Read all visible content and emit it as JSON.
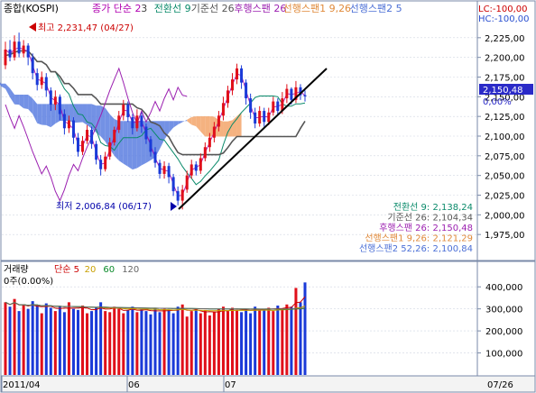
{
  "chart_data": [
    {
      "type": "candlestick",
      "title": "종합(KOSPI)",
      "legend": [
        {
          "text": "종가 단순 2",
          "color": "#b000b0"
        },
        {
          "text": "3",
          "color": "#404040"
        },
        {
          "text": "전환선 9",
          "color": "#0a8a6a"
        },
        {
          "text": "기준선 26",
          "color": "#555555"
        },
        {
          "text": "후행스팬 26",
          "color": "#9b1fb0"
        },
        {
          "text": "선행스팬1 9,26",
          "color": "#e08a3a"
        },
        {
          "text": "선행스팬2 5",
          "color": "#4b6fd6"
        }
      ],
      "lc_label": "LC:-100,00",
      "hc_label": "HC:-100,00",
      "ylim": [
        1950,
        2250
      ],
      "y_ticks": [
        "2,225,00",
        "2,200,00",
        "2,175,00",
        "2,150,00",
        "2,125,00",
        "2,100,00",
        "2,075,00",
        "2,050,00",
        "2,025,00",
        "2,000,00",
        "1,975,00"
      ],
      "y_tick_values": [
        2225,
        2200,
        2175,
        2150,
        2125,
        2100,
        2075,
        2050,
        2025,
        2000,
        1975
      ],
      "current_price": {
        "text": "2,150,48",
        "value": 2150.48
      },
      "current_pct": "0,00%",
      "high_annotation": {
        "text": "최고 2,231,47 (04/27)",
        "value": 2231.47
      },
      "low_annotation": {
        "text": "최저 2,006,84 (06/17)",
        "value": 2006.84
      },
      "indicator_values": [
        {
          "text": "전환선 9: 2,138,24",
          "color": "#0a8a6a"
        },
        {
          "text": "기준선 26: 2,104,34",
          "color": "#555555"
        },
        {
          "text": "후행스팬 26: 2,150,48",
          "color": "#9b1fb0"
        },
        {
          "text": "선행스팬1 9,26: 2,121,29",
          "color": "#e08a3a"
        },
        {
          "text": "선행스팬2 52,26: 2,100,84",
          "color": "#4b6fd6"
        }
      ],
      "candles": [
        {
          "o": 2190,
          "c": 2210,
          "h": 2220,
          "l": 2185
        },
        {
          "o": 2210,
          "c": 2200,
          "h": 2222,
          "l": 2195
        },
        {
          "o": 2200,
          "c": 2220,
          "h": 2228,
          "l": 2196
        },
        {
          "o": 2220,
          "c": 2205,
          "h": 2231.47,
          "l": 2200
        },
        {
          "o": 2205,
          "c": 2215,
          "h": 2222,
          "l": 2200
        },
        {
          "o": 2215,
          "c": 2200,
          "h": 2218,
          "l": 2190
        },
        {
          "o": 2200,
          "c": 2180,
          "h": 2205,
          "l": 2172
        },
        {
          "o": 2180,
          "c": 2165,
          "h": 2186,
          "l": 2158
        },
        {
          "o": 2165,
          "c": 2175,
          "h": 2182,
          "l": 2160
        },
        {
          "o": 2175,
          "c": 2158,
          "h": 2180,
          "l": 2150
        },
        {
          "o": 2158,
          "c": 2140,
          "h": 2162,
          "l": 2132
        },
        {
          "o": 2140,
          "c": 2150,
          "h": 2158,
          "l": 2133
        },
        {
          "o": 2150,
          "c": 2128,
          "h": 2153,
          "l": 2120
        },
        {
          "o": 2128,
          "c": 2110,
          "h": 2134,
          "l": 2102
        },
        {
          "o": 2110,
          "c": 2120,
          "h": 2126,
          "l": 2104
        },
        {
          "o": 2120,
          "c": 2098,
          "h": 2124,
          "l": 2090
        },
        {
          "o": 2098,
          "c": 2080,
          "h": 2104,
          "l": 2074
        },
        {
          "o": 2080,
          "c": 2094,
          "h": 2100,
          "l": 2076
        },
        {
          "o": 2094,
          "c": 2108,
          "h": 2114,
          "l": 2090
        },
        {
          "o": 2108,
          "c": 2090,
          "h": 2112,
          "l": 2084
        },
        {
          "o": 2090,
          "c": 2070,
          "h": 2094,
          "l": 2064
        },
        {
          "o": 2070,
          "c": 2058,
          "h": 2076,
          "l": 2050
        },
        {
          "o": 2058,
          "c": 2074,
          "h": 2080,
          "l": 2055
        },
        {
          "o": 2074,
          "c": 2092,
          "h": 2098,
          "l": 2070
        },
        {
          "o": 2092,
          "c": 2108,
          "h": 2112,
          "l": 2088
        },
        {
          "o": 2108,
          "c": 2126,
          "h": 2132,
          "l": 2104
        },
        {
          "o": 2126,
          "c": 2140,
          "h": 2146,
          "l": 2120
        },
        {
          "o": 2140,
          "c": 2124,
          "h": 2144,
          "l": 2118
        },
        {
          "o": 2124,
          "c": 2110,
          "h": 2128,
          "l": 2102
        },
        {
          "o": 2110,
          "c": 2126,
          "h": 2134,
          "l": 2106
        },
        {
          "o": 2126,
          "c": 2112,
          "h": 2130,
          "l": 2104
        },
        {
          "o": 2112,
          "c": 2096,
          "h": 2116,
          "l": 2090
        },
        {
          "o": 2096,
          "c": 2080,
          "h": 2100,
          "l": 2074
        },
        {
          "o": 2080,
          "c": 2066,
          "h": 2086,
          "l": 2060
        },
        {
          "o": 2066,
          "c": 2052,
          "h": 2070,
          "l": 2046
        },
        {
          "o": 2052,
          "c": 2062,
          "h": 2068,
          "l": 2046
        },
        {
          "o": 2062,
          "c": 2048,
          "h": 2066,
          "l": 2040
        },
        {
          "o": 2048,
          "c": 2030,
          "h": 2052,
          "l": 2024
        },
        {
          "o": 2030,
          "c": 2018,
          "h": 2036,
          "l": 2012
        },
        {
          "o": 2018,
          "c": 2032,
          "h": 2038,
          "l": 2006.84
        },
        {
          "o": 2032,
          "c": 2050,
          "h": 2056,
          "l": 2028
        },
        {
          "o": 2050,
          "c": 2064,
          "h": 2070,
          "l": 2046
        },
        {
          "o": 2064,
          "c": 2056,
          "h": 2068,
          "l": 2050
        },
        {
          "o": 2056,
          "c": 2072,
          "h": 2078,
          "l": 2052
        },
        {
          "o": 2072,
          "c": 2086,
          "h": 2092,
          "l": 2068
        },
        {
          "o": 2086,
          "c": 2098,
          "h": 2104,
          "l": 2080
        },
        {
          "o": 2098,
          "c": 2112,
          "h": 2118,
          "l": 2092
        },
        {
          "o": 2112,
          "c": 2126,
          "h": 2132,
          "l": 2106
        },
        {
          "o": 2126,
          "c": 2142,
          "h": 2150,
          "l": 2120
        },
        {
          "o": 2142,
          "c": 2158,
          "h": 2164,
          "l": 2136
        },
        {
          "o": 2158,
          "c": 2172,
          "h": 2180,
          "l": 2152
        },
        {
          "o": 2172,
          "c": 2186,
          "h": 2192,
          "l": 2166
        },
        {
          "o": 2186,
          "c": 2168,
          "h": 2190,
          "l": 2160
        },
        {
          "o": 2168,
          "c": 2148,
          "h": 2172,
          "l": 2140
        },
        {
          "o": 2148,
          "c": 2130,
          "h": 2154,
          "l": 2122
        },
        {
          "o": 2130,
          "c": 2116,
          "h": 2136,
          "l": 2110
        },
        {
          "o": 2116,
          "c": 2132,
          "h": 2138,
          "l": 2112
        },
        {
          "o": 2132,
          "c": 2118,
          "h": 2136,
          "l": 2112
        },
        {
          "o": 2118,
          "c": 2130,
          "h": 2136,
          "l": 2114
        },
        {
          "o": 2130,
          "c": 2144,
          "h": 2150,
          "l": 2126
        },
        {
          "o": 2144,
          "c": 2132,
          "h": 2148,
          "l": 2126
        },
        {
          "o": 2132,
          "c": 2148,
          "h": 2156,
          "l": 2128
        },
        {
          "o": 2148,
          "c": 2160,
          "h": 2166,
          "l": 2142
        },
        {
          "o": 2160,
          "c": 2146,
          "h": 2162,
          "l": 2140
        },
        {
          "o": 2146,
          "c": 2162,
          "h": 2170,
          "l": 2142
        },
        {
          "o": 2162,
          "c": 2152,
          "h": 2166,
          "l": 2146
        },
        {
          "o": 2152,
          "c": 2150.48,
          "h": 2158,
          "l": 2144
        }
      ],
      "volume": {
        "label": "거래량",
        "legend": [
          {
            "text": "단순 5",
            "color": "#cc0000"
          },
          {
            "text": "20",
            "color": "#c8a000"
          },
          {
            "text": "60",
            "color": "#0a8a2a"
          },
          {
            "text": "120",
            "color": "#666666"
          }
        ],
        "current_label": "0주(0.00%)",
        "ylim": [
          0,
          450000
        ],
        "y_ticks": [
          "400,000",
          "300,000",
          "200,000",
          "100,000"
        ],
        "y_tick_values": [
          400000,
          300000,
          200000,
          100000
        ],
        "values": [
          330000,
          310000,
          345000,
          290000,
          320000,
          300000,
          335000,
          315000,
          280000,
          325000,
          305000,
          290000,
          310000,
          285000,
          330000,
          300000,
          295000,
          315000,
          280000,
          290000,
          305000,
          330000,
          290000,
          285000,
          310000,
          300000,
          280000,
          295000,
          310000,
          285000,
          300000,
          290000,
          275000,
          305000,
          285000,
          300000,
          295000,
          280000,
          310000,
          320000,
          265000,
          290000,
          300000,
          280000,
          295000,
          270000,
          285000,
          300000,
          310000,
          290000,
          305000,
          295000,
          285000,
          300000,
          280000,
          310000,
          295000,
          300000,
          305000,
          290000,
          315000,
          300000,
          320000,
          310000,
          395000,
          330000,
          420000
        ]
      },
      "x_labels": [
        "2011/04",
        "06",
        "07",
        "07/26"
      ]
    }
  ]
}
